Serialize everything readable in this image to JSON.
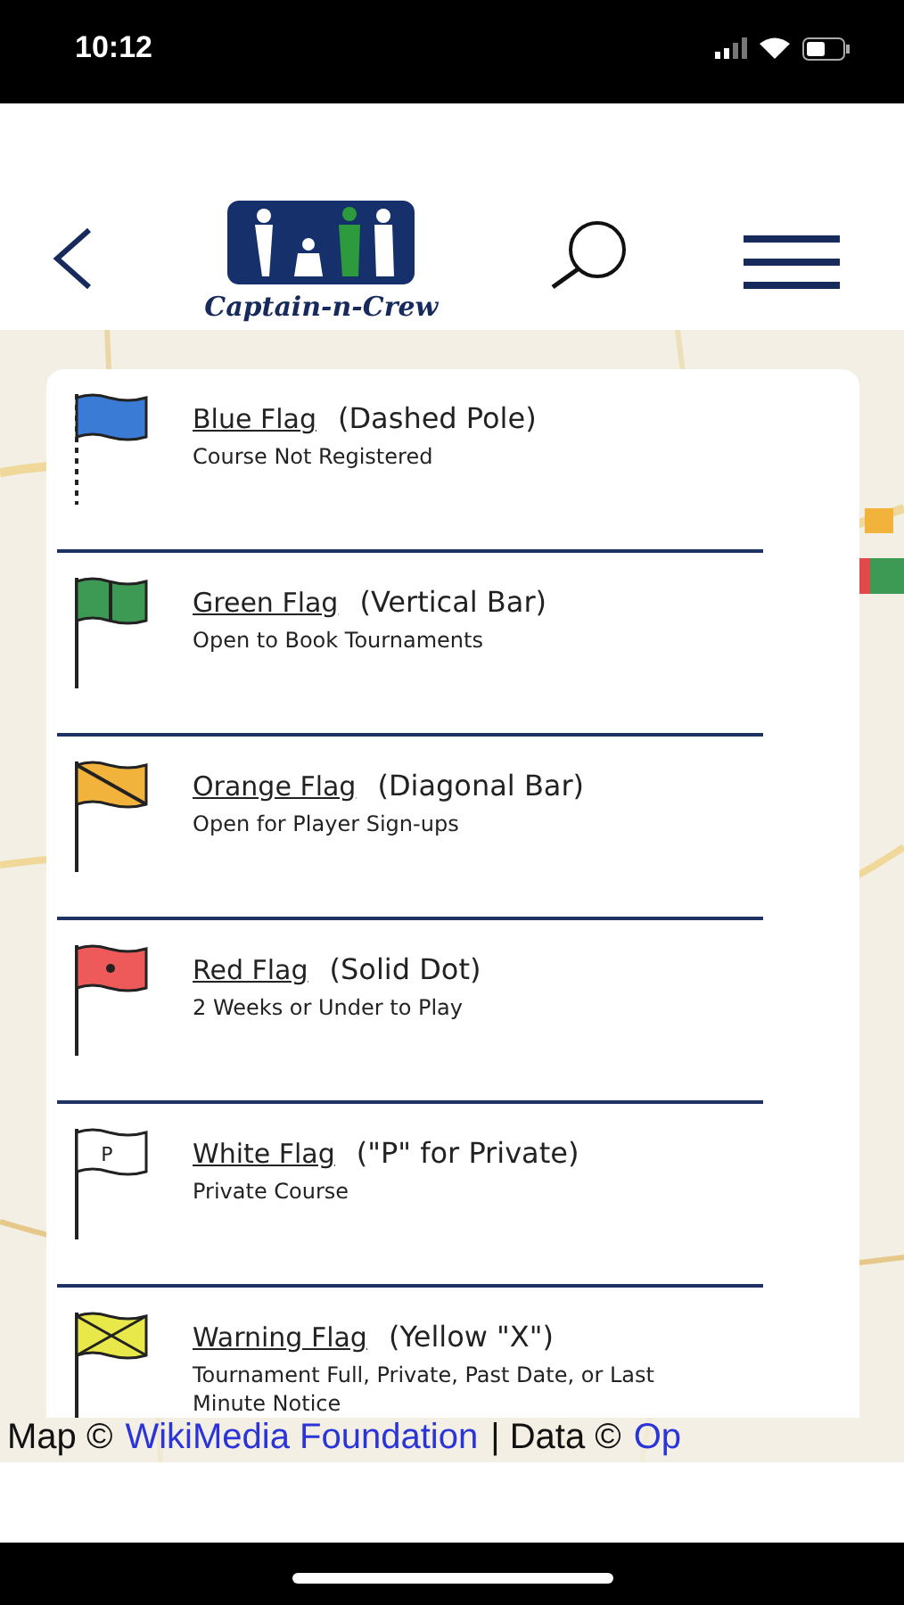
{
  "status_bar": {
    "time": "10:12"
  },
  "header": {
    "brand": "Captain-n-Crew"
  },
  "legend": [
    {
      "kind": "dashed",
      "color": "#3a7bd5",
      "title": "Blue Flag",
      "note": "(Dashed Pole)",
      "description": "Course Not Registered"
    },
    {
      "kind": "vertical",
      "color": "#3c9a55",
      "title": "Green Flag",
      "note": "(Vertical Bar)",
      "description": "Open to Book Tournaments"
    },
    {
      "kind": "diagonal",
      "color": "#f2b33d",
      "title": "Orange Flag",
      "note": "(Diagonal Bar)",
      "description": "Open for Player Sign-ups"
    },
    {
      "kind": "dot",
      "color": "#ee5a5a",
      "title": "Red Flag",
      "note": "(Solid Dot)",
      "description": "2 Weeks or Under to Play"
    },
    {
      "kind": "letter",
      "color": "#ffffff",
      "mark": "P",
      "title": "White Flag",
      "note": "(\"P\" for Private)",
      "description": "Private Course"
    },
    {
      "kind": "cross",
      "color": "#e8e84a",
      "title": "Warning Flag",
      "note": "(Yellow \"X\")",
      "description": "Tournament Full, Private, Past Date, or Last Minute Notice"
    }
  ],
  "attribution": {
    "prefix": "Map ©",
    "link": "WikiMedia Foundation",
    "middle": "| Data ©",
    "link2": "Op"
  }
}
